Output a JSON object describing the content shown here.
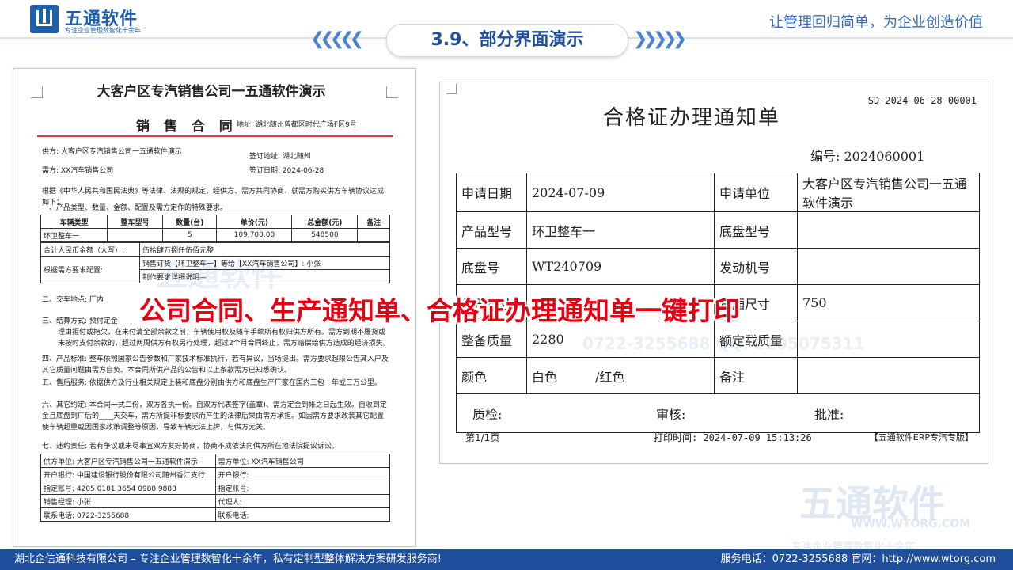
{
  "header": {
    "logo_name": "五通软件",
    "logo_sub": "专注企业管理数智化十余年",
    "title": "3.9、部分界面演示",
    "slogan": "让管理回归简单，为企业创造价值"
  },
  "watermark": {
    "brand": "五通软件",
    "url": "WWW.WTORG.COM",
    "tagline": "专注企业管理数智化十余年",
    "contact": "0722-3255688 QQ: 2205075311"
  },
  "banner": "公司合同、生产通知单、合格证办理通知单一键打印",
  "contract": {
    "title": "大客户区专汽销售公司一五通软件演示",
    "subtitle": "销 售 合 同",
    "address": "地址: 湖北随州曾都区时代广场F区9号",
    "supplier_label": "供方:",
    "supplier": "大客户区专汽销售公司一五通软件演示",
    "buyer_label": "需方:",
    "buyer": "XX汽车销售公司",
    "sign_place_label": "签订地址:",
    "sign_place": "湖北随州",
    "sign_date_label": "签订日期:",
    "sign_date": "2024-06-28",
    "intro": "根据《中华人民共和国民法典》等法律、法规的规定，经供方、需方共同协商，就需方购买供方车辆协议达成如下：",
    "clause1": "一、产品类型、数量、金额、配置及需方定作的特殊要求。",
    "headers": [
      "车辆类型",
      "整车型号",
      "数量(台)",
      "单价(元)",
      "总金额(元)",
      "备注"
    ],
    "row": [
      "环卫整车一",
      "",
      "5",
      "109,700.00",
      "548500",
      ""
    ],
    "total_label": "合计人民币金额（大写）:",
    "total_words": "伍拾肆万捌仟伍佰元整",
    "req_label": "根据需方要求配置:",
    "req_line1": "销售订货【环卫整车一】等给【XX汽车销售公司】: 小张",
    "req_line2": "制作要求详细说明—",
    "clauses": [
      "二、交车地点: 厂内",
      "三、结算方式: 预付定金",
      "理由拒付或拖欠，在未付清全部余款之前，车辆使用权及随车手续所有权归供方所有。需方到期不履货或未按时支付余款的，超过两周供方有权另行处理，超过2个月合同终止，需方赔偿给供方造成的经济损失。",
      "四、产品标准: 整车依照国家公告参数和厂家技术标准执行，若有异议，当场提出。需方要求超限公告其入户及其它质量问题由需方自负。本合同所供产品的公告和以上条款需方已知悉确认。",
      "五、售后服务: 依据供方及行业相关规定上装和底盘分别由供方和底盘生产厂家在国内三包一年或三万公里。",
      "六、其它约定: 本合同一式二份，双方各执一份。自双方代表签字(盖章)、需方定金到帐之日起生效。自收到定金且底盘到厂后的____天交车，需方所提非标要求而产生的法律后果由需方承担。如因需方要求改装其它配置使车辆超重或因国家政策调整等原因，导致车辆无法上牌，与供方无关。",
      "七、违约责任: 若有争议或未尽事宜双方友好协商，协商不成依法向供方所在地法院提议诉讼。"
    ],
    "sign_left": [
      "供方单位: 大客户区专汽销售公司一五通软件演示",
      "开户银行: 中国建设银行股份有限公司随州香江支行",
      "指定账号: 4205 0181 3654 0988 9888",
      "销售经理: 小张",
      "联系电话: 0722-3255688"
    ],
    "sign_right": [
      "需方单位: XX汽车销售公司",
      "开户银行:",
      "指定账号:",
      "代理人:",
      "联系电话:"
    ]
  },
  "notice": {
    "code": "SD-2024-06-28-00001",
    "title": "合格证办理通知单",
    "number": "编号: 2024060001",
    "rows": [
      [
        "申请日期",
        "2024-07-09",
        "申请单位",
        "大客户区专汽销售公司一五通软件演示"
      ],
      [
        "产品型号",
        "环卫整车一",
        "底盘型号",
        ""
      ],
      [
        "底盘号",
        "WT240709",
        "发动机号",
        ""
      ],
      [
        "外形尺寸",
        "",
        "货厢尺寸",
        "750"
      ],
      [
        "整备质量",
        "2280",
        "额定载质量",
        ""
      ],
      [
        "颜色",
        "白色　　　/红色",
        "备注",
        ""
      ]
    ],
    "sign_row": [
      "质检:",
      "审核:",
      "批准:"
    ],
    "page": "第1/1页",
    "print_time": "打印时间: 2024-07-09 15:13:26",
    "edition": "【五通软件ERP专汽专版】"
  },
  "footer": {
    "left": "湖北企信通科技有限公司 – 专注企业管理数智化十余年，私有定制型整体解决方案研发服务商!",
    "right": "服务电话：0722-3255688  官网：http://www.wtorg.com"
  }
}
